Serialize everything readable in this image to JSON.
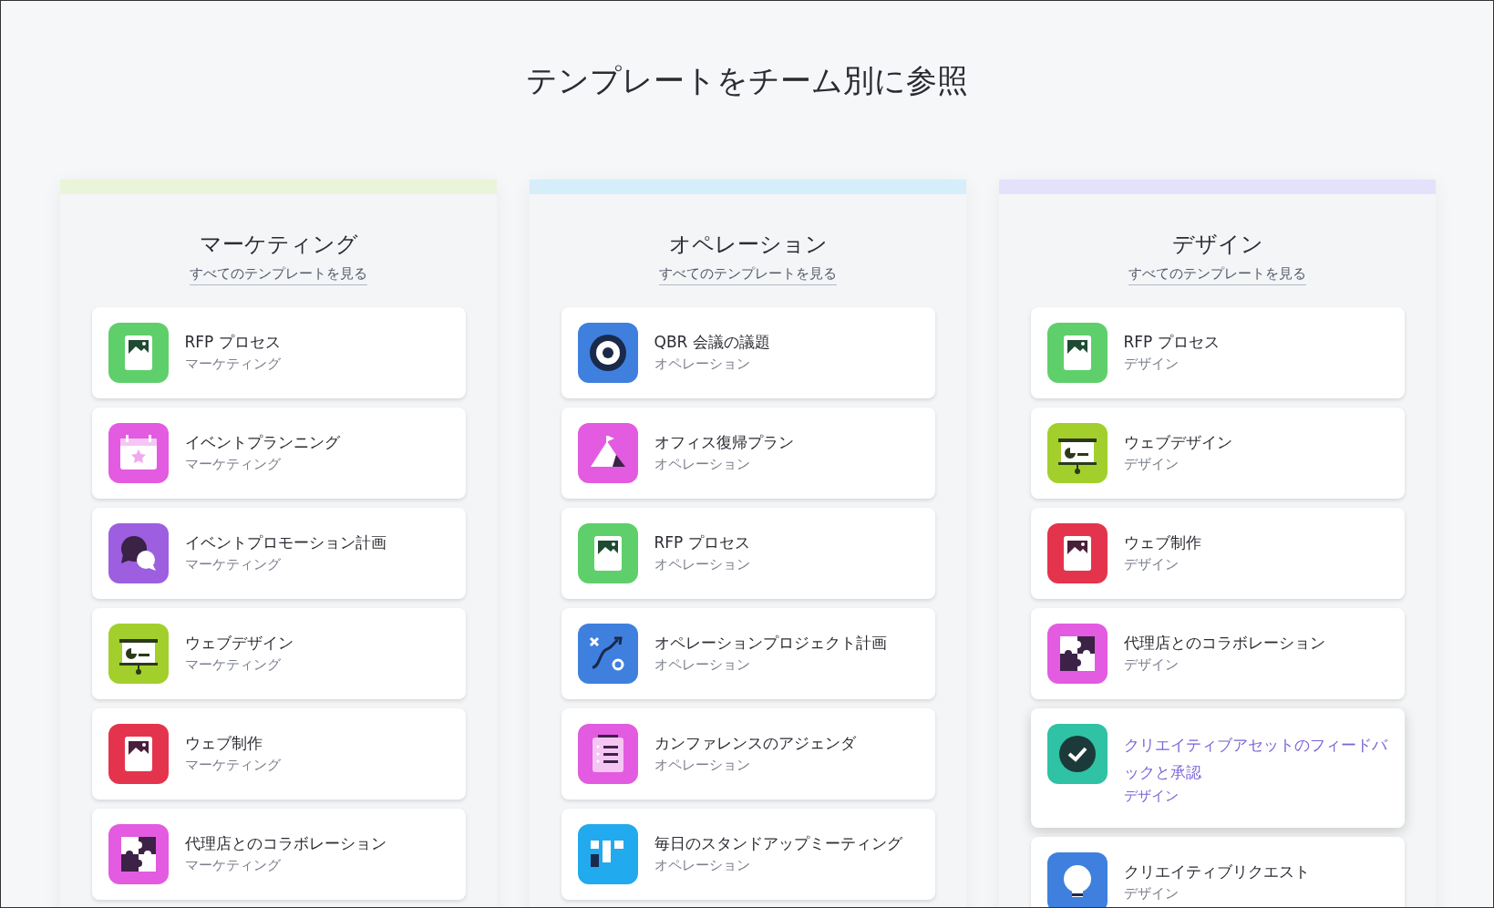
{
  "heading": "テンプレートをチーム別に参照",
  "teams": [
    {
      "title": "マーケティング",
      "link": "すべてのテンプレートを見る",
      "color": "#eaf4d9",
      "templates": [
        {
          "name": "RFP プロセス",
          "team": "マーケティング",
          "kind": "image",
          "color": "#5fcf6c",
          "hovered": false
        },
        {
          "name": "イベントプランニング",
          "team": "マーケティング",
          "kind": "calendar",
          "color": "#e35be0",
          "hovered": false
        },
        {
          "name": "イベントプロモーション計画",
          "team": "マーケティング",
          "kind": "chat",
          "color": "#9d5ee0",
          "hovered": false
        },
        {
          "name": "ウェブデザイン",
          "team": "マーケティング",
          "kind": "presentation",
          "color": "#a3cf2c",
          "hovered": false
        },
        {
          "name": "ウェブ制作",
          "team": "マーケティング",
          "kind": "image",
          "color": "#e4344d",
          "hovered": false
        },
        {
          "name": "代理店とのコラボレーション",
          "team": "マーケティング",
          "kind": "puzzle",
          "color": "#e35be0",
          "hovered": false
        }
      ]
    },
    {
      "title": "オペレーション",
      "link": "すべてのテンプレートを見る",
      "color": "#d5eefa",
      "templates": [
        {
          "name": "QBR 会議の議題",
          "team": "オペレーション",
          "kind": "target",
          "color": "#3f80de",
          "hovered": false
        },
        {
          "name": "オフィス復帰プラン",
          "team": "オペレーション",
          "kind": "mountain",
          "color": "#e35be0",
          "hovered": false
        },
        {
          "name": "RFP プロセス",
          "team": "オペレーション",
          "kind": "image",
          "color": "#5fcf6c",
          "hovered": false
        },
        {
          "name": "オペレーションプロジェクト計画",
          "team": "オペレーション",
          "kind": "route",
          "color": "#3f80de",
          "hovered": false
        },
        {
          "name": "カンファレンスのアジェンダ",
          "team": "オペレーション",
          "kind": "checklist",
          "color": "#e35be0",
          "hovered": false
        },
        {
          "name": "毎日のスタンドアップミーティング",
          "team": "オペレーション",
          "kind": "board",
          "color": "#22aaee",
          "hovered": false
        }
      ]
    },
    {
      "title": "デザイン",
      "link": "すべてのテンプレートを見る",
      "color": "#e4e2fb",
      "templates": [
        {
          "name": "RFP プロセス",
          "team": "デザイン",
          "kind": "image",
          "color": "#5fcf6c",
          "hovered": false
        },
        {
          "name": "ウェブデザイン",
          "team": "デザイン",
          "kind": "presentation",
          "color": "#a3cf2c",
          "hovered": false
        },
        {
          "name": "ウェブ制作",
          "team": "デザイン",
          "kind": "image",
          "color": "#e4344d",
          "hovered": false
        },
        {
          "name": "代理店とのコラボレーション",
          "team": "デザイン",
          "kind": "puzzle",
          "color": "#e35be0",
          "hovered": false
        },
        {
          "name": "クリエイティブアセットのフィードバックと承認",
          "team": "デザイン",
          "kind": "check",
          "color": "#2fc2a4",
          "hovered": true
        },
        {
          "name": "クリエイティブリクエスト",
          "team": "デザイン",
          "kind": "bulb",
          "color": "#3f80de",
          "hovered": false
        }
      ]
    }
  ]
}
